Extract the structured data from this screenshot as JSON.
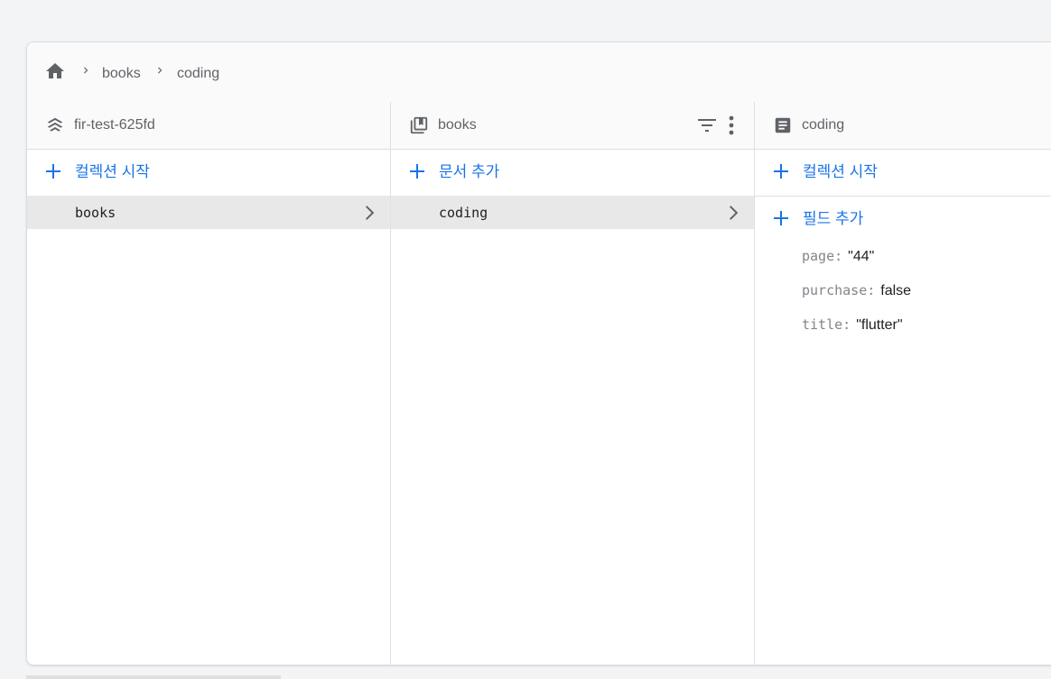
{
  "breadcrumb": {
    "items": [
      "books",
      "coding"
    ]
  },
  "columns": [
    {
      "header": "fir-test-625fd",
      "add_label": "컬렉션 시작",
      "items": [
        {
          "label": "books"
        }
      ]
    },
    {
      "header": "books",
      "add_label": "문서 추가",
      "items": [
        {
          "label": "coding"
        }
      ]
    },
    {
      "header": "coding",
      "add_collection_label": "컬렉션 시작",
      "add_field_label": "필드 추가",
      "fields": [
        {
          "key": "page:",
          "value": "\"44\""
        },
        {
          "key": "purchase:",
          "value": "false"
        },
        {
          "key": "title:",
          "value": "\"flutter\""
        }
      ]
    }
  ],
  "icons": {
    "home": "home-icon",
    "chevron": "chevron-right-icon",
    "project": "firestore-icon",
    "collection": "collection-icon",
    "document": "document-icon",
    "filter": "filter-icon",
    "more": "more-vert-icon",
    "add": "plus-icon"
  },
  "colors": {
    "accent": "#1a73e8",
    "selected_row": "#e8e8e8",
    "header_bg": "#fafafa"
  }
}
